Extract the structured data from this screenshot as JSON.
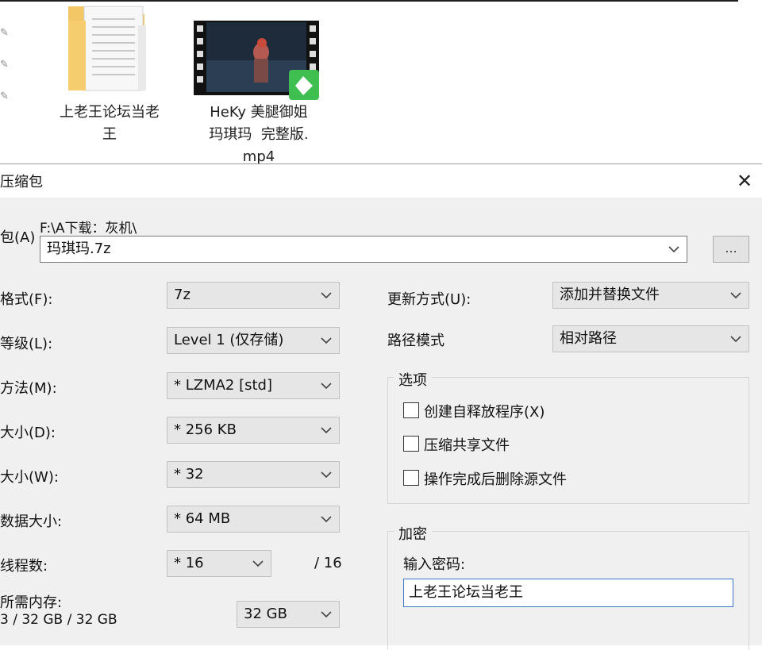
{
  "explorer": {
    "files": [
      {
        "label": "上老王论坛当老\n王",
        "icon": "folder-icon"
      },
      {
        "label": "HeKy 美腿御姐\n玛琪玛  完整版.\nmp4",
        "icon": "video-thumbnail-icon"
      }
    ]
  },
  "dialog": {
    "title": "压缩包",
    "close_glyph": "✕",
    "archive": {
      "label": "包(A)",
      "path": "F:\\A下载：灰机\\",
      "filename": "玛琪玛.7z",
      "browse_label": "..."
    },
    "left": {
      "format": {
        "label": "格式(F):",
        "value": "7z"
      },
      "level": {
        "label": "等级(L):",
        "value": "Level 1 (仅存储)"
      },
      "method": {
        "label": "方法(M):",
        "value": "* LZMA2 [std]"
      },
      "dict": {
        "label": "大小(D):",
        "value": "* 256 KB"
      },
      "word": {
        "label": "大小(W):",
        "value": "* 32"
      },
      "solid": {
        "label": "数据大小:",
        "value": "* 64 MB"
      },
      "threads": {
        "label": "线程数:",
        "value": "* 16",
        "max": "/ 16"
      },
      "memory": {
        "label": "所需内存:",
        "usage": "3 / 32 GB / 32 GB",
        "value": "32 GB"
      }
    },
    "right": {
      "update_mode": {
        "label": "更新方式(U):",
        "value": "添加并替换文件"
      },
      "path_mode": {
        "label": "路径模式",
        "value": "相对路径"
      },
      "options": {
        "title": "选项",
        "items": [
          {
            "label": "创建自释放程序(X)",
            "checked": false
          },
          {
            "label": "压缩共享文件",
            "checked": false
          },
          {
            "label": "操作完成后删除源文件",
            "checked": false
          }
        ]
      },
      "encryption": {
        "title": "加密",
        "password_label": "输入密码:",
        "password_value": "上老王论坛当老王"
      }
    }
  }
}
